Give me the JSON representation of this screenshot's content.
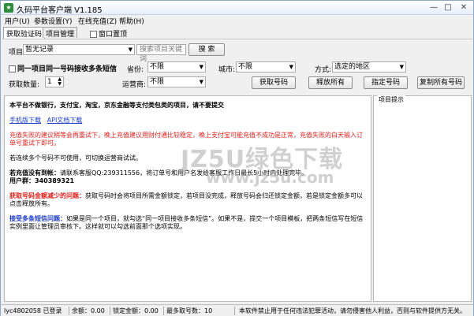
{
  "window": {
    "title": "久码平台客户端 V1.185",
    "min": "—",
    "max": "□",
    "close": "✕"
  },
  "menu": [
    "用户(U)",
    "参数设置(Y)",
    "在线充值(Z)",
    "帮助(H)"
  ],
  "tabs": {
    "items": [
      "获取验证码",
      "项目管理"
    ],
    "pin_label": "窗口置顶"
  },
  "form": {
    "project_label": "项目:",
    "project_value": "暂无记录",
    "search_placeholder": "搜索项目关键词",
    "search_button": "搜 索",
    "multi_sms_label": "同一项目同一号码接收多条短信",
    "province_label": "省份:",
    "province_value": "不限",
    "city_label": "城市:",
    "city_value": "不限",
    "mode_label": "方式:",
    "mode_value": "选定的地区",
    "quantity_label": "获取数量:",
    "quantity_value": "1",
    "carrier_label": "运营商:",
    "carrier_value": "不限",
    "buttons": [
      "获取号码",
      "释放所有",
      "指定号码",
      "复制所有号码"
    ]
  },
  "content": {
    "notice": "本平台不做银行，支付宝，淘宝，京东金融等支付类包类的项目，请不要提交",
    "links": [
      "手机版下载",
      "API文档下载"
    ],
    "red_notice": "充值失败的建议稍等会再重试下，晚上充值建议用财付通比较稳定，晚上支付宝可能充值不成功是正常，充值失败的白天输入订单号重试下即可。",
    "tip": "若连续多个号码不可使用，可切换运营商试试。",
    "recharge_title": "若充值没有到帐：",
    "recharge_text": "请联系客服QQ:239311556，将订单号和用户名发给客服工作日最长5小时内处理完毕。",
    "user_id": "用户群：340389321",
    "less_title": "获取号码金额减少的问题：",
    "less_text": "获取号码时会将项目所需金额锁定，若项目没完成，释放号码会归还锁定金额，若是锁定金额多可以点击释放所有。",
    "multi_title": "接受多条短信问题：",
    "multi_text": "如果是同一个项目，就勾选“同一项目接收多条短信”。如果不是，提交一个项目模板，把两条短信写在短信实例里面让管理员审核下。这样就可以勾选前面那个选项实现。"
  },
  "hint": {
    "title": "项目提示"
  },
  "watermark": {
    "line1": "JZ5U绿色下载",
    "line2": "www.jz5u.com"
  },
  "status": {
    "user": "lyc4802058 已登录",
    "balance": "余额：0.00",
    "locked": "锁定金额：0.00",
    "max_count": "最多取号数：10",
    "disclaimer": "本软件禁止用于任何违法犯罪活动，请勿侵害他人利益，否则与软件提供方无关。"
  }
}
